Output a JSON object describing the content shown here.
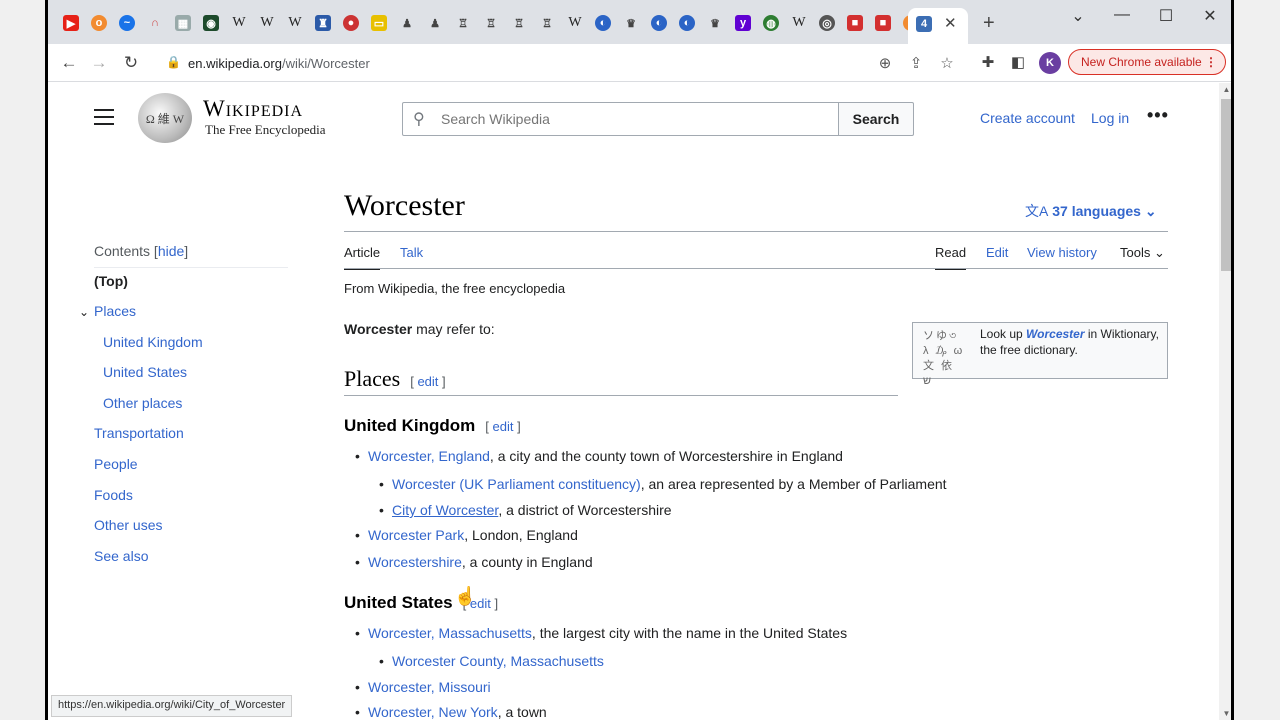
{
  "browser": {
    "url_host": "en.wikipedia.org",
    "url_path": "/wiki/Worcester",
    "new_chrome_label": "New Chrome available",
    "profile_initial": "K",
    "status_url": "https://en.wikipedia.org/wiki/City_of_Worcester"
  },
  "header": {
    "wordmark": "Wikipedia",
    "tagline": "The Free Encyclopedia",
    "search_placeholder": "Search Wikipedia",
    "search_button": "Search",
    "create_account": "Create account",
    "log_in": "Log in"
  },
  "toc": {
    "title": "Contents",
    "hide": "hide",
    "items": [
      {
        "label": "(Top)"
      },
      {
        "label": "Places"
      },
      {
        "label": "United Kingdom"
      },
      {
        "label": "United States"
      },
      {
        "label": "Other places"
      },
      {
        "label": "Transportation"
      },
      {
        "label": "People"
      },
      {
        "label": "Foods"
      },
      {
        "label": "Other uses"
      },
      {
        "label": "See also"
      }
    ]
  },
  "article": {
    "title": "Worcester",
    "languages": "37 languages",
    "tabs": {
      "article": "Article",
      "talk": "Talk",
      "read": "Read",
      "edit": "Edit",
      "history": "View history",
      "tools": "Tools"
    },
    "site_sub": "From Wikipedia, the free encyclopedia",
    "intro_bold": "Worcester",
    "intro_rest": " may refer to:",
    "wiktionary": {
      "pre": "Look up ",
      "term": "Worcester",
      "post": " in Wiktionary, the free dictionary."
    },
    "section_places": "Places",
    "edit_label": "edit",
    "section_uk": "United Kingdom",
    "section_us": "United States",
    "uk_items": [
      {
        "link": "Worcester, England",
        "text": ", a city and the county town of Worcestershire in England"
      },
      {
        "link": "Worcester (UK Parliament constituency)",
        "text": ", an area represented by a Member of Parliament"
      },
      {
        "link": "City of Worcester",
        "text": ", a district of Worcestershire"
      },
      {
        "link": "Worcester Park",
        "text": ", London, England"
      },
      {
        "link": "Worcestershire",
        "text": ", a county in England"
      }
    ],
    "us_items": [
      {
        "link": "Worcester, Massachusetts",
        "text": ", the largest city with the name in the United States"
      },
      {
        "link": "Worcester County, Massachusetts",
        "text": ""
      },
      {
        "link": "Worcester, Missouri",
        "text": ""
      },
      {
        "link": "Worcester, New York",
        "text": ", a town"
      }
    ]
  }
}
